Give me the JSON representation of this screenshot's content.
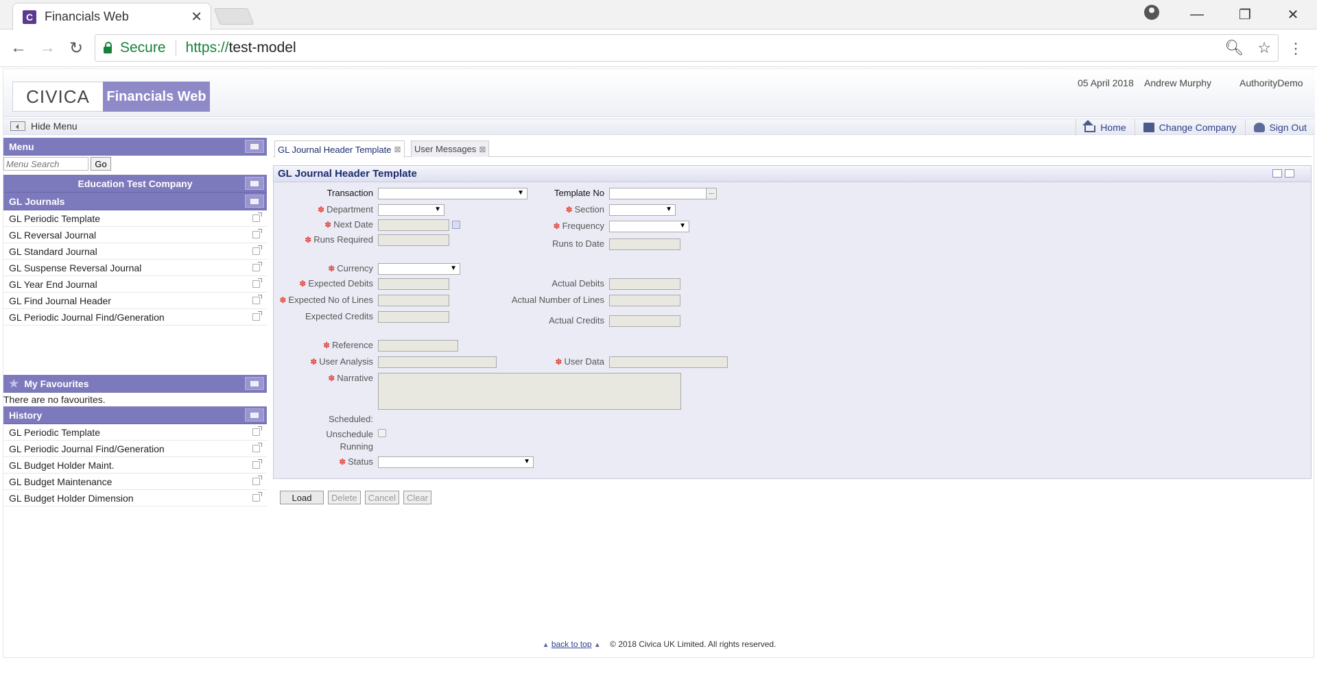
{
  "browser": {
    "tab_title": "Financials Web",
    "favicon_letter": "C",
    "secure_label": "Secure",
    "url_scheme": "https://",
    "url_host": "test-model"
  },
  "header": {
    "logo_text": "CIVICA",
    "brand_text": "Financials Web",
    "date": "05 April 2018",
    "user": "Andrew Murphy",
    "authority": "AuthorityDemo"
  },
  "navbar": {
    "hide_menu": "Hide Menu",
    "home": "Home",
    "change_company": "Change Company",
    "sign_out": "Sign Out"
  },
  "sidebar": {
    "menu_title": "Menu",
    "search_placeholder": "Menu Search",
    "go_label": "Go",
    "company": "Education Test Company",
    "section_title": "GL Journals",
    "items": [
      "GL Periodic Template",
      "GL Reversal Journal",
      "GL Standard Journal",
      "GL Suspense Reversal Journal",
      "GL Year End Journal",
      "GL Find Journal Header",
      "GL Periodic Journal Find/Generation"
    ],
    "favourites_title": "My Favourites",
    "no_favourites": "There are no favourites.",
    "history_title": "History",
    "history": [
      "GL Periodic Template",
      "GL Periodic Journal Find/Generation",
      "GL Budget Holder Maint.",
      "GL Budget Maintenance",
      "GL Budget Holder Dimension"
    ]
  },
  "tabs": [
    {
      "label": "GL Journal Header Template",
      "active": true
    },
    {
      "label": "User Messages",
      "active": false
    }
  ],
  "form": {
    "title": "GL Journal Header Template",
    "labels": {
      "transaction": "Transaction",
      "template_no": "Template No",
      "department": "Department",
      "section": "Section",
      "next_date": "Next Date",
      "frequency": "Frequency",
      "runs_required": "Runs Required",
      "runs_to_date": "Runs to Date",
      "currency": "Currency",
      "expected_debits": "Expected Debits",
      "actual_debits": "Actual Debits",
      "expected_lines": "Expected No of Lines",
      "actual_lines": "Actual Number of Lines",
      "expected_credits": "Expected Credits",
      "actual_credits": "Actual Credits",
      "reference": "Reference",
      "user_analysis": "User Analysis",
      "user_data": "User Data",
      "narrative": "Narrative",
      "scheduled": "Scheduled:",
      "unschedule": "Unschedule",
      "running": "Running",
      "status": "Status"
    },
    "lookup_label": "...",
    "required_mark": "✽"
  },
  "buttons": {
    "load": "Load",
    "delete": "Delete",
    "cancel": "Cancel",
    "clear": "Clear"
  },
  "footer": {
    "back_to_top": "back to top",
    "copyright": "© 2018 Civica UK Limited. All rights reserved."
  }
}
